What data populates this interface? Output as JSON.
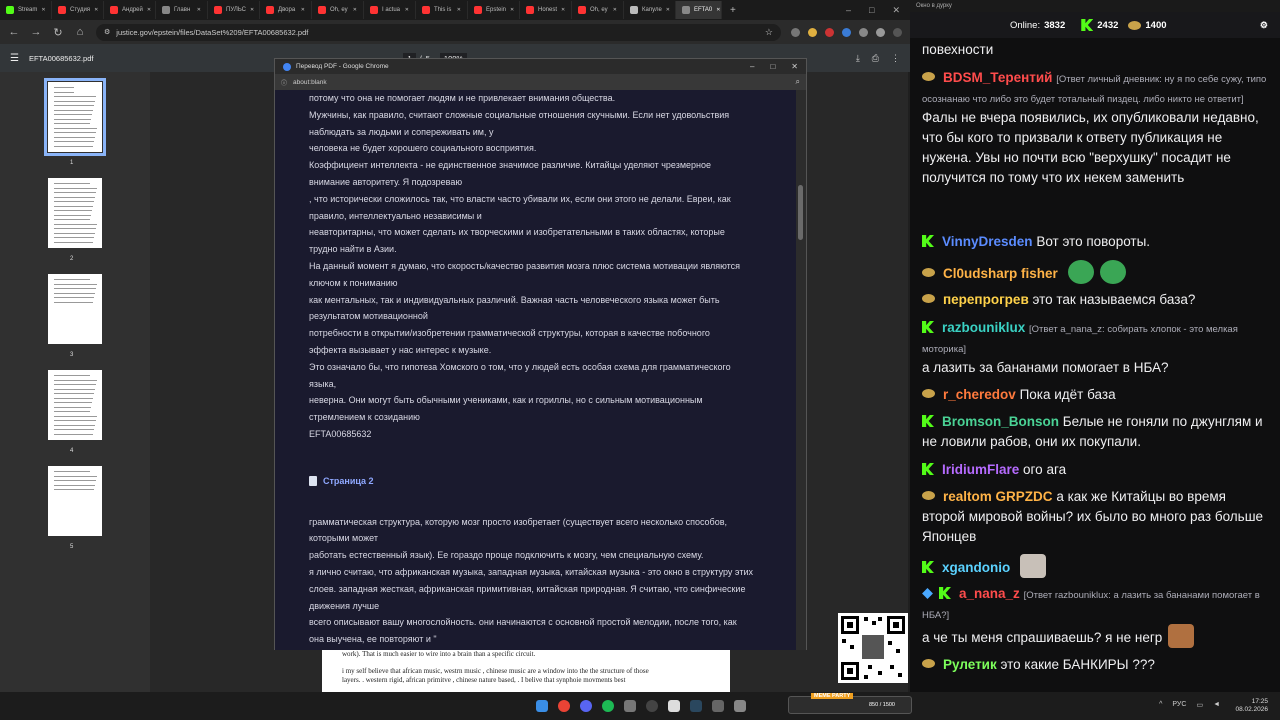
{
  "tabs": [
    {
      "label": "Stream",
      "color": "#53fc18"
    },
    {
      "label": "Студия",
      "color": "#ff3333"
    },
    {
      "label": "Андрей",
      "color": "#ff3333"
    },
    {
      "label": "Главн",
      "color": "#888888"
    },
    {
      "label": "ПУЛЬС",
      "color": "#ff3333"
    },
    {
      "label": "Двора",
      "color": "#ff3333"
    },
    {
      "label": "Oh, ey",
      "color": "#ff3333"
    },
    {
      "label": "I actua",
      "color": "#ff3333"
    },
    {
      "label": "This is",
      "color": "#ff3333"
    },
    {
      "label": "Epstein",
      "color": "#ff3333"
    },
    {
      "label": "Honest",
      "color": "#ff3333"
    },
    {
      "label": "Oh, ey",
      "color": "#ff3333"
    },
    {
      "label": "Капуле",
      "color": "#bbbbbb"
    },
    {
      "label": "EFTA0",
      "color": "#888888"
    }
  ],
  "browser": {
    "url": "justice.gov/epstein/files/DataSet%209/EFTA00685632.pdf",
    "new_tab": "+"
  },
  "pdf": {
    "filename": "EFTA00685632.pdf",
    "page_input": "1",
    "page_sep": "/",
    "page_total": "5",
    "zoom": "100%",
    "thumb_labels": [
      "1",
      "2",
      "3",
      "4",
      "5"
    ],
    "page_lines": [
      "work). That is much easier to wire into a brain than a specific circuit.",
      "",
      "i my self  believe that african music, westrn music , chinese music  are a window into the the structure of those",
      "layers.   .    western rigid,  african primitve , chinese nature based, .     I belive that synphoie movments best"
    ]
  },
  "popup": {
    "title": "Перевод PDF - Google Chrome",
    "address": "about:blank",
    "lines": [
      "потому что она не помогает людям и не привлекает внимания общества.",
      "Мужчины, как правило, считают сложные социальные отношения скучными. Если нет удовольствия",
      "наблюдать за людьми и сопереживать им, у",
      "человека не будет хорошего социального восприятия.",
      "Коэффициент интеллекта - не единственное значимое различие. Китайцы уделяют чрезмерное",
      "внимание авторитету. Я подозреваю",
      ", что исторически сложилось так, что власти часто убивали их, если они этого не делали. Евреи, как",
      "правило, интеллектуально независимы и",
      "неавторитарны, что может сделать их творческими и изобретательными в таких областях, которые",
      "трудно найти в Азии.",
      "На данный момент я думаю, что скорость/качество развития мозга плюс система мотивации являются",
      "ключом к пониманию",
      "как ментальных, так и индивидуальных различий. Важная часть человеческого языка может быть",
      "результатом мотивационной",
      "потребности в открытии/изобретении грамматической структуры, которая в качестве побочного",
      "эффекта вызывает у нас интерес к музыке.",
      "Это означало бы, что гипотеза Хомского о том, что у людей есть особая схема для грамматического",
      "языка,",
      "неверна. Они могут быть обычными учениками, как и гориллы, но с сильным мотивационным",
      "стремлением к созиданию",
      "EFTA00685632"
    ],
    "page2_heading": "Страница 2",
    "lines2": [
      "грамматическая структура, которую мозг просто изобретает (существует всего несколько способов,",
      "которыми может",
      "работать естественный язык). Ее гораздо проще подключить к мозгу, чем специальную схему.",
      "я лично считаю, что африканская музыка, западная музыка, китайская музыка - это окно в структуру этих",
      "слоев.  западная жесткая, африканская примитивная, китайская природная. Я считаю, что синфические",
      "движения лучше",
      "всего описывают вашу многослойность. они начинаются с основной простой мелодии, после того, как",
      "она выучена, ее повторяют и \""
    ]
  },
  "chat": {
    "window_title": "Окно в дурку",
    "online_label": "Online:",
    "online_count": "3832",
    "kick_count": "2432",
    "coin_count": "1400",
    "messages": [
      {
        "text": "повехности"
      },
      {
        "user": "BDSM_Терентий",
        "user_color": "#ff4c4c",
        "reply": "[Ответ личный дневник: ну я по себе сужу, типо осознанаю что либо это будет тотальный пиздец. либо никто не ответит]",
        "text": "Фалы не вчера появились, их опубликовали недавно, что бы кого то призвали к ответу публикация не нужена. Увы но почти всю \"верхушку\" посадит не получится по тому что их некем заменить"
      },
      {
        "user": "VinnyDresden",
        "user_color": "#5b8cff",
        "text": "Вот это повороты."
      },
      {
        "user": "Cl0udsharp fisher",
        "user_color": "#ffb347",
        "text": ""
      },
      {
        "user": "перепрогрев",
        "user_color": "#ffd24a",
        "text": "это так называемся база?"
      },
      {
        "user": "razbouniklux",
        "user_color": "#3ad1c3",
        "reply": "[Ответ a_nana_z: собирать хлопок - это мелкая моторика]",
        "text": "а лазить за бананами помогает в НБА?"
      },
      {
        "user": "r_cheredov",
        "user_color": "#ff7a3d",
        "text": "Пока идёт база"
      },
      {
        "user": "Bromson_Bonson",
        "user_color": "#4ad295",
        "text": "Белые не гоняли по джунглям и не ловили рабов, они их покупали."
      },
      {
        "user": "IridiumFlare",
        "user_color": "#b66bff",
        "text": "ого ага"
      },
      {
        "user": "realtom",
        "user_color": "#ffb347",
        "mention": "GRPZDC",
        "text": "а как же Китайцы во время второй мировой войны? их было во много раз больше Японцев"
      },
      {
        "user": "xgandonio",
        "user_color": "#5bd2ff",
        "text": ""
      },
      {
        "user": "a_nana_z",
        "user_color": "#ff4c4c",
        "reply": "[Ответ razbouniklux: а лазить за бананами помогает в НБА?]",
        "text": "а че ты меня спрашиваешь? я не негр"
      },
      {
        "user": "Рулетик",
        "user_color": "#7dff5b",
        "text": "это какие БАНКИРЫ ???"
      }
    ]
  },
  "meme": {
    "label": "MEME PARTY",
    "progress_text": "850 / 1500"
  },
  "taskbar": {
    "lang": "РУС",
    "time": "17:25",
    "date": "08.02.2026"
  }
}
